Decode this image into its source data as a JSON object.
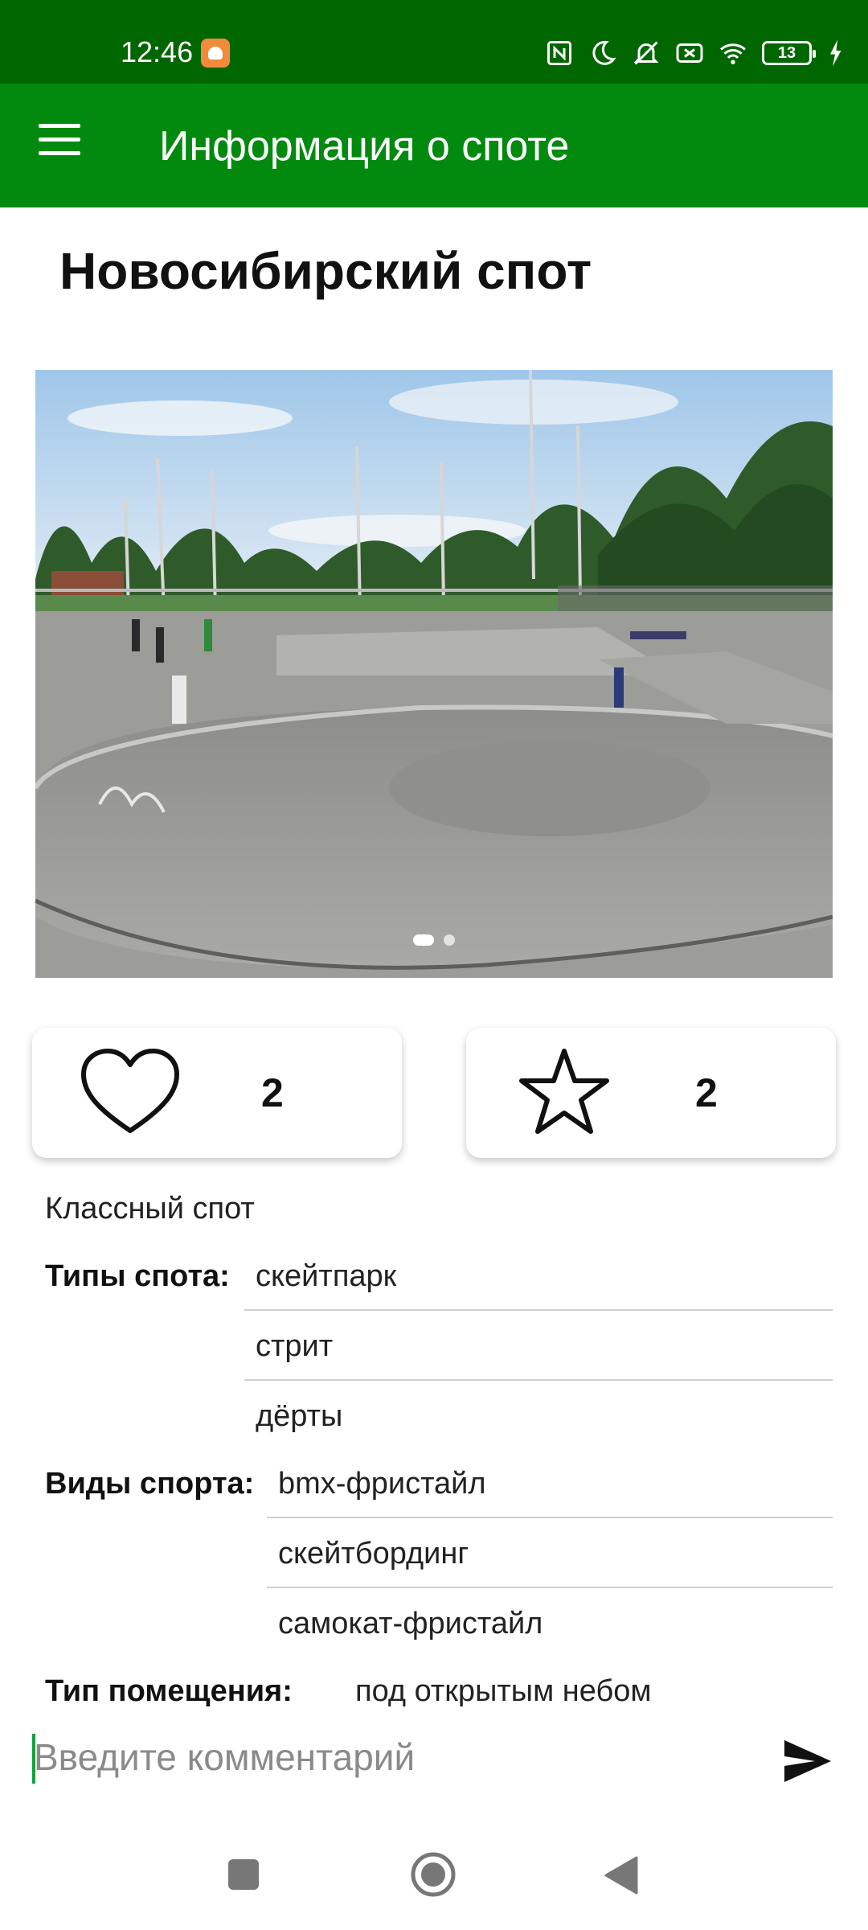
{
  "status_bar": {
    "time": "12:46",
    "battery_level": "13",
    "icons": [
      "nfc-icon",
      "moon-icon",
      "mute-icon",
      "no-sim-icon",
      "wifi-icon",
      "battery-icon",
      "charging-icon"
    ]
  },
  "app_bar": {
    "title": "Информация о споте",
    "menu_icon": "hamburger-menu-icon"
  },
  "spot": {
    "name": "Новосибирский спот",
    "photo_pager": {
      "total": 2,
      "active_index": 0
    },
    "likes": {
      "icon": "heart-outline-icon",
      "count": "2"
    },
    "favorites": {
      "icon": "star-outline-icon",
      "count": "2"
    },
    "description": "Классный спот",
    "spot_types": {
      "label": "Типы спота:",
      "values": [
        "скейтпарк",
        "стрит",
        "дёрты"
      ]
    },
    "sports": {
      "label": "Виды спорта:",
      "values": [
        "bmx-фристайл",
        "скейтбординг",
        "самокат-фристайл"
      ]
    },
    "premises_type": {
      "label": "Тип помещения:",
      "value": "под открытым небом"
    }
  },
  "comment": {
    "placeholder": "Введите комментарий",
    "value": "",
    "send_icon": "send-icon"
  },
  "nav_bar": {
    "icons": [
      "recents-square-icon",
      "home-circle-icon",
      "back-triangle-icon"
    ]
  },
  "colors": {
    "status_bar": "#006600",
    "app_bar": "#028a0f",
    "accent_cursor": "#1a9e3f"
  }
}
